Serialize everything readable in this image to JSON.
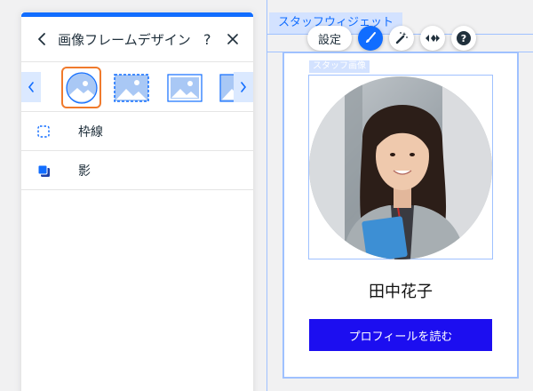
{
  "panel": {
    "title": "画像フレームデザイン",
    "help_label": "?",
    "close_label": "×",
    "options": [
      {
        "label": "枠線",
        "icon": "border-dashed-icon"
      },
      {
        "label": "影",
        "icon": "shadow-icon"
      }
    ],
    "frames": [
      "circle-frame-icon",
      "dashed-rect-frame-icon",
      "framed-rect-icon",
      "partial-frame-icon"
    ],
    "selected_frame": 0
  },
  "canvas": {
    "widget_tag": "スタッフウィジェット",
    "image_label": "スタッフ画像",
    "toolbar": {
      "settings_label": "設定"
    },
    "staff_name": "田中花子",
    "cta_label": "プロフィールを読む"
  },
  "colors": {
    "accent": "#116dff",
    "selected_frame_border": "#f07a2c",
    "cta_background": "#1c0ef0",
    "guide_line": "#9fc1ff"
  }
}
